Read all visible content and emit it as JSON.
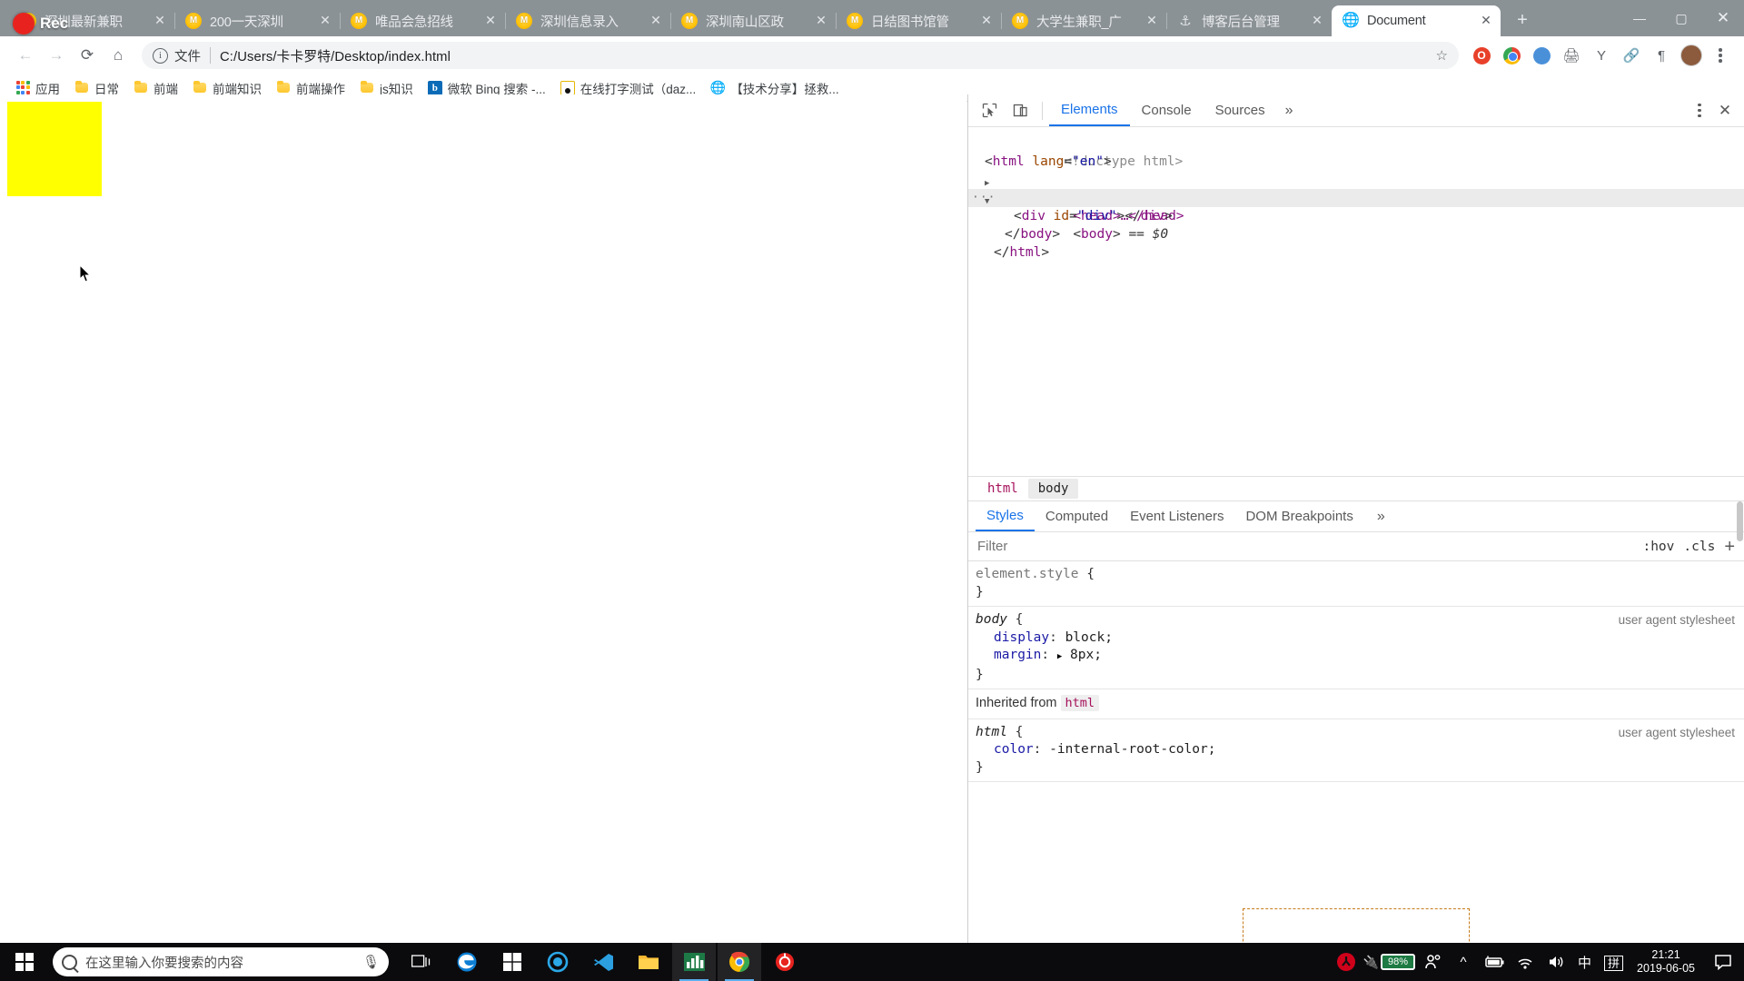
{
  "browser": {
    "tabs": [
      {
        "title": "深圳最新兼职",
        "favicon": "meituan-icon",
        "active": false
      },
      {
        "title": "200一天深圳",
        "favicon": "meituan-icon",
        "active": false
      },
      {
        "title": "唯品会急招线",
        "favicon": "meituan-icon",
        "active": false
      },
      {
        "title": "深圳信息录入",
        "favicon": "meituan-icon",
        "active": false
      },
      {
        "title": "深圳南山区政",
        "favicon": "meituan-icon",
        "active": false
      },
      {
        "title": "日结图书馆管",
        "favicon": "meituan-icon",
        "active": false
      },
      {
        "title": "大学生兼职_广",
        "favicon": "meituan-icon",
        "active": false
      },
      {
        "title": "博客后台管理",
        "favicon": "anchor-icon",
        "active": false
      },
      {
        "title": "Document",
        "favicon": "globe-icon",
        "active": true
      }
    ],
    "tab_close_label": "✕",
    "new_tab_label": "+",
    "window_controls": {
      "minimize": "—",
      "maximize": "▢",
      "close": "✕"
    },
    "toolbar": {
      "back": "←",
      "forward": "→",
      "reload": "⟳",
      "home": "⌂",
      "bookmark_star": "☆",
      "extensions": [
        "opera-icon",
        "chrome-icon",
        "blue-circle-icon",
        "printer-icon",
        "y-icon",
        "link-icon",
        "pilcrow-icon"
      ],
      "profile_avatar": "avatar",
      "menu": "kebab-menu"
    },
    "omnibox": {
      "info_icon": "ⓘ",
      "security_label": "文件",
      "url": "C:/Users/卡卡罗特/Desktop/index.html"
    },
    "bookmarks": [
      {
        "label": "应用",
        "icon": "apps-grid-icon"
      },
      {
        "label": "日常",
        "icon": "folder-icon"
      },
      {
        "label": "前端",
        "icon": "folder-icon"
      },
      {
        "label": "前端知识",
        "icon": "folder-icon"
      },
      {
        "label": "前端操作",
        "icon": "folder-icon"
      },
      {
        "label": "js知识",
        "icon": "folder-icon"
      },
      {
        "label": "微软 Bing 搜索 -...",
        "icon": "bing-icon"
      },
      {
        "label": "在线打字测试（daz...",
        "icon": "daz-icon"
      },
      {
        "label": "【技术分享】拯救...",
        "icon": "globe-icon"
      }
    ]
  },
  "page": {
    "yellow_box_color": "#ffff00"
  },
  "devtools": {
    "inspect_icon": "inspect-cursor-icon",
    "device_toggle_icon": "device-toolbar-icon",
    "tabs": [
      {
        "label": "Elements",
        "active": true
      },
      {
        "label": "Console",
        "active": false
      },
      {
        "label": "Sources",
        "active": false
      }
    ],
    "more_tabs": "»",
    "settings": "kebab-menu",
    "close": "✕",
    "dom": {
      "lines": [
        {
          "indent": 0,
          "html_doctype": "<!doctype html>"
        },
        {
          "indent": 0,
          "text": "<html lang=\"en\">"
        },
        {
          "indent": 1,
          "text": "<head>…</head>"
        },
        {
          "indent": 0,
          "text": "<body> == $0"
        },
        {
          "indent": 2,
          "text": "<div id=\"div\"></div>"
        },
        {
          "indent": 1,
          "text": "</body>"
        },
        {
          "indent": 0,
          "text": "</html>"
        }
      ],
      "doctype": "<!doctype html>",
      "html_open_tag": "html",
      "html_attr_name": "lang",
      "html_attr_value": "\"en\"",
      "head_collapsed": "<head>…</head>",
      "body_tag": "body",
      "body_selected_marker": "== $0",
      "div_tag": "div",
      "div_attr_name": "id",
      "div_attr_value": "\"div\"",
      "body_close": "</body>",
      "html_close": "</html>"
    },
    "breadcrumbs": [
      {
        "label": "html",
        "active": false
      },
      {
        "label": "body",
        "active": true
      }
    ],
    "styles_tabs": [
      {
        "label": "Styles",
        "active": true
      },
      {
        "label": "Computed",
        "active": false
      },
      {
        "label": "Event Listeners",
        "active": false
      },
      {
        "label": "DOM Breakpoints",
        "active": false
      }
    ],
    "styles_more": "»",
    "filter_placeholder": "Filter",
    "hov_label": ":hov",
    "cls_label": ".cls",
    "new_rule_label": "+",
    "rules": [
      {
        "selector": "element.style",
        "origin": "",
        "open": "{",
        "close": "}",
        "declarations": []
      },
      {
        "selector": "body",
        "origin": "user agent stylesheet",
        "open": "{",
        "close": "}",
        "declarations": [
          {
            "prop": "display",
            "value": "block;"
          },
          {
            "prop": "margin",
            "value": "8px;",
            "expandable": true
          }
        ]
      }
    ],
    "inherited_label": "Inherited from",
    "inherited_from": "html",
    "inherited_rule": {
      "selector": "html",
      "origin": "user agent stylesheet",
      "open": "{",
      "close": "}",
      "declarations": [
        {
          "prop": "color",
          "value": "-internal-root-color;"
        }
      ]
    }
  },
  "recording": {
    "label": "Rec",
    "dot_color": "#e8231f"
  },
  "taskbar": {
    "start_icon": "windows-logo-icon",
    "search_placeholder": "在这里输入你要搜索的内容",
    "search_icon": "search-circle-icon",
    "mic_icon": "microphone-icon",
    "task_view_icon": "task-view-icon",
    "apps": [
      {
        "name": "edge-icon",
        "active": false
      },
      {
        "name": "microsoft-store-icon",
        "active": false
      },
      {
        "name": "cortana-icon",
        "active": false
      },
      {
        "name": "vscode-icon",
        "active": false
      },
      {
        "name": "file-explorer-icon",
        "active": false
      },
      {
        "name": "chart-app-icon",
        "active": true
      },
      {
        "name": "chrome-icon",
        "active": true
      },
      {
        "name": "recorder-icon",
        "active": false
      }
    ],
    "tray": {
      "app_icon": "red-shield-icon",
      "battery_percent": "98%",
      "people_icon": "people-icon",
      "chevron_icon": "^",
      "power_icon": "battery-icon",
      "wifi_icon": "wifi-icon",
      "volume_icon": "volume-icon",
      "ime_mode": "中",
      "ime_pinyin": "拼",
      "time": "21:21",
      "date": "2019-06-05",
      "notifications_icon": "notification-icon"
    }
  }
}
